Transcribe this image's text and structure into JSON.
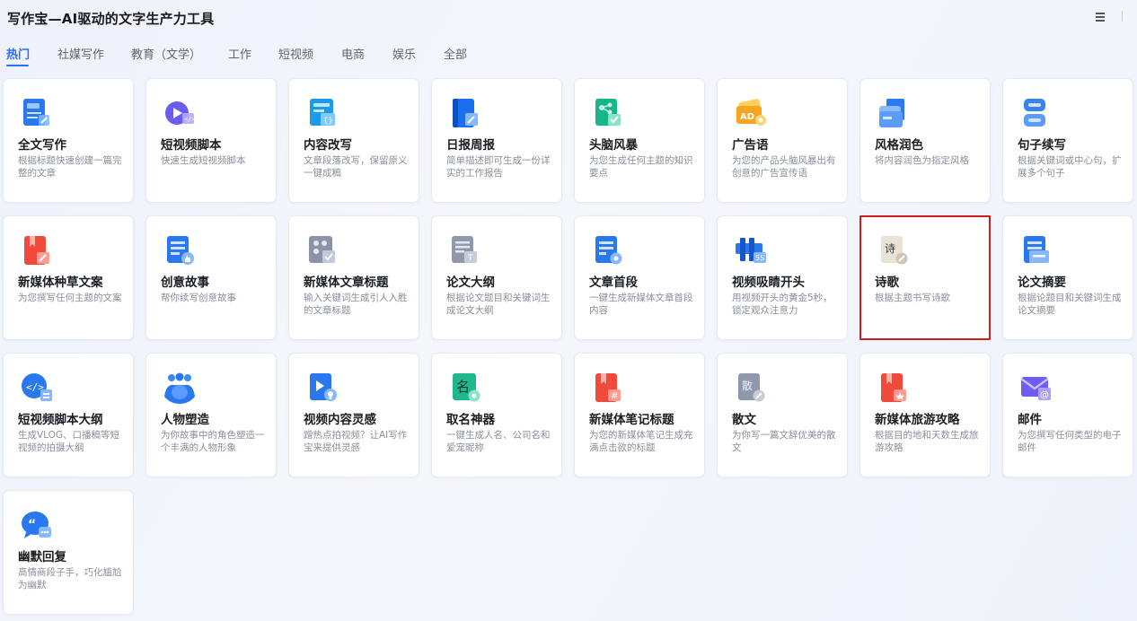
{
  "app": {
    "title": "写作宝—AI驱动的文字生产力工具",
    "menu_icon": "hamburger-menu-icon"
  },
  "tabs": [
    {
      "label": "热门",
      "active": true
    },
    {
      "label": "社媒写作",
      "active": false
    },
    {
      "label": "教育（文学）",
      "active": false
    },
    {
      "label": "工作",
      "active": false
    },
    {
      "label": "短视频",
      "active": false
    },
    {
      "label": "电商",
      "active": false
    },
    {
      "label": "娱乐",
      "active": false
    },
    {
      "label": "全部",
      "active": false
    }
  ],
  "accent_color": "#2f6bff",
  "selection_color": "#d21c1c",
  "cards": [
    {
      "title": "全文写作",
      "desc": "根据标题快速创建一篇完整的文章",
      "icon": "document-edit-icon"
    },
    {
      "title": "短视频脚本",
      "desc": "快速生成短视频脚本",
      "icon": "video-play-icon"
    },
    {
      "title": "内容改写",
      "desc": "文章段落改写，保留原义一键成稿",
      "icon": "code-document-icon"
    },
    {
      "title": "日报周报",
      "desc": "简单描述即可生成一份详实的工作报告",
      "icon": "notebook-edit-icon"
    },
    {
      "title": "头脑风暴",
      "desc": "为您生成任何主题的知识要点",
      "icon": "mindmap-check-icon"
    },
    {
      "title": "广告语",
      "desc": "为您的产品头脑风暴出有创意的广告宣传语",
      "icon": "ad-card-icon"
    },
    {
      "title": "风格润色",
      "desc": "将内容润色为指定风格",
      "icon": "folder-stack-icon"
    },
    {
      "title": "句子续写",
      "desc": "根据关键词或中心句，扩展多个句子",
      "icon": "text-lines-icon"
    },
    {
      "title": "新媒体种草文案",
      "desc": "为您撰写任何主题的文案",
      "icon": "red-book-icon"
    },
    {
      "title": "创意故事",
      "desc": "帮你续写创意故事",
      "icon": "document-thumb-icon"
    },
    {
      "title": "新媒体文章标题",
      "desc": "输入关键词生成引人入胜的文章标题",
      "icon": "grid-check-icon"
    },
    {
      "title": "论文大纲",
      "desc": "根据论文题目和关键词生成论文大纲",
      "icon": "list-text-icon"
    },
    {
      "title": "文章首段",
      "desc": "一键生成新媒体文章首段内容",
      "icon": "document-gear-icon"
    },
    {
      "title": "视频吸睛开头",
      "desc": "用视频开头的黄金5秒，锁定观众注意力",
      "icon": "video-5s-icon"
    },
    {
      "title": "诗歌",
      "desc": "根据主题书写诗歌",
      "icon": "poem-scroll-icon",
      "glyph": "诗",
      "selected": true
    },
    {
      "title": "论文摘要",
      "desc": "根据论题目和关键词生成论文摘要",
      "icon": "paper-summary-icon"
    },
    {
      "title": "短视频脚本大纲",
      "desc": "生成VLOG、口播稿等短视频的拍摄大纲",
      "icon": "code-bubble-icon"
    },
    {
      "title": "人物塑造",
      "desc": "为你故事中的角色塑造一个丰满的人物形象",
      "icon": "people-group-icon"
    },
    {
      "title": "视频内容灵感",
      "desc": "蹭热点拍视频？让AI写作宝来提供灵感",
      "icon": "video-bulb-icon"
    },
    {
      "title": "取名神器",
      "desc": "一键生成人名、公司名和爱宠昵称",
      "icon": "name-stamp-icon",
      "glyph": "名"
    },
    {
      "title": "新媒体笔记标题",
      "desc": "为您的新媒体笔记生成充满点击欲的标题",
      "icon": "red-note-hash-icon"
    },
    {
      "title": "散文",
      "desc": "为你写一篇文辞优美的散文",
      "icon": "prose-scroll-icon",
      "glyph": "散"
    },
    {
      "title": "新媒体旅游攻略",
      "desc": "根据目的地和天数生成旅游攻略",
      "icon": "travel-book-icon"
    },
    {
      "title": "邮件",
      "desc": "为您撰写任何类型的电子邮件",
      "icon": "mail-at-icon"
    },
    {
      "title": "幽默回复",
      "desc": "高情商段子手，巧化尴尬为幽默",
      "icon": "quote-bubble-icon"
    }
  ]
}
